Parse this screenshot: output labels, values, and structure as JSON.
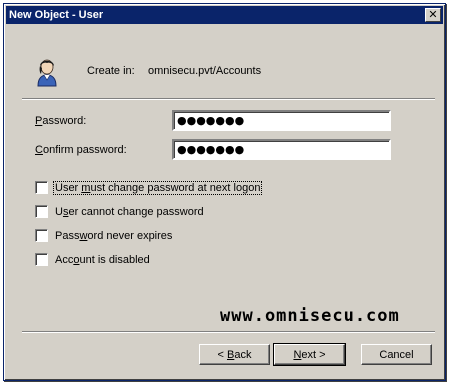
{
  "window": {
    "title": "New Object - User",
    "close_glyph": "✕"
  },
  "header": {
    "icon": "user-icon",
    "create_in_label": "Create in:",
    "create_in_path": "omnisecu.pvt/Accounts"
  },
  "form": {
    "password": {
      "label_mnemonic": "P",
      "label_rest": "assword:",
      "value": "●●●●●●●"
    },
    "confirm_password": {
      "label_mnemonic": "C",
      "label_rest": "onfirm password:",
      "value": "●●●●●●●"
    }
  },
  "options": [
    {
      "pre": "User ",
      "mn": "m",
      "post": "ust change password at next logon",
      "checked": false
    },
    {
      "pre": "U",
      "mn": "s",
      "post": "er cannot change password",
      "checked": false
    },
    {
      "pre": "Pass",
      "mn": "w",
      "post": "ord never expires",
      "checked": false
    },
    {
      "pre": "Acc",
      "mn": "o",
      "post": "unt is disabled",
      "checked": false
    }
  ],
  "watermark": "www.omnisecu.com",
  "buttons": {
    "back": {
      "prefix": "< ",
      "mn": "B",
      "rest": "ack"
    },
    "next": {
      "mn": "N",
      "rest": "ext >"
    },
    "cancel": "Cancel"
  }
}
